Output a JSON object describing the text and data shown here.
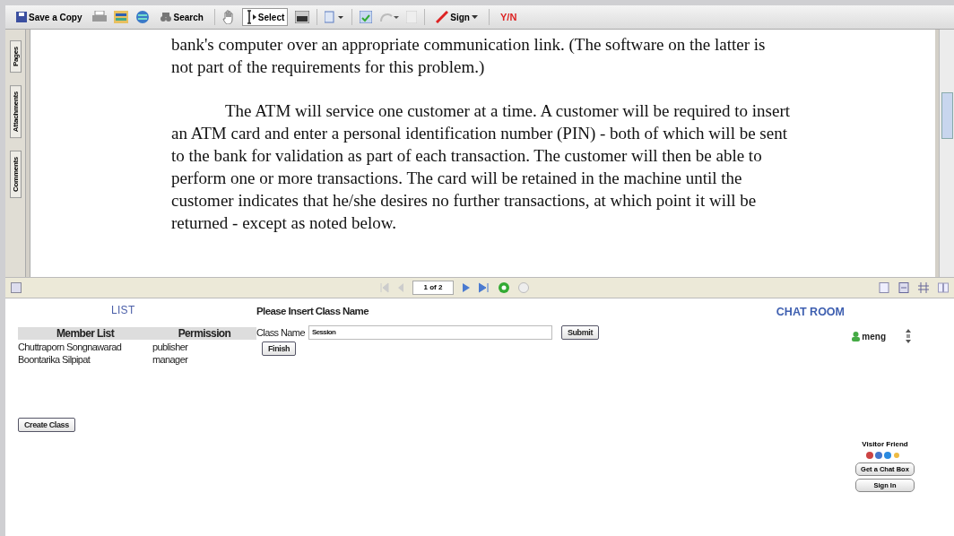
{
  "toolbar": {
    "save_label": "Save a Copy",
    "search_label": "Search",
    "select_label": "Select",
    "select_selected": true,
    "sign_label": "Sign",
    "yes_no_label": "Y/N"
  },
  "side_tabs": [
    {
      "label": "Pages"
    },
    {
      "label": "Attachments"
    },
    {
      "label": "Comments"
    }
  ],
  "document": {
    "paragraphs": [
      {
        "indent": false,
        "text": "bank's computer over an appropriate communication link. (The software on the latter is not part of the requirements for this problem.)"
      },
      {
        "indent": true,
        "text": "The ATM will service one customer at a time. A customer will be required to insert an ATM card and enter a personal identification number (PIN) - both of which will be sent to the bank for validation as part of each transaction. The customer will then be able to perform one or more transactions. The card will be retained in the machine until the customer indicates that he/she desires no further transactions, at which point it will be returned - except as noted below."
      }
    ]
  },
  "navigation": {
    "page_field": "1 of 2"
  },
  "list_panel": {
    "title": "LIST",
    "columns": [
      "Member List",
      "Permission"
    ],
    "rows": [
      [
        "Chuttraporn Songnawarad",
        "publisher"
      ],
      [
        "Boontarika Silpipat",
        "manager"
      ]
    ],
    "create_button": "Create Class"
  },
  "class_form": {
    "heading": "Please Insert Class Name",
    "label": "Class Name",
    "value": "Session",
    "submit_button": "Submit",
    "finish_button": "Finish"
  },
  "chat": {
    "title": "CHAT ROOM",
    "users": [
      {
        "name": "meng"
      }
    ],
    "visitor_label": "Visitor Friend",
    "get_button": "Get a Chat Box",
    "sign_in_button": "Sign In"
  }
}
